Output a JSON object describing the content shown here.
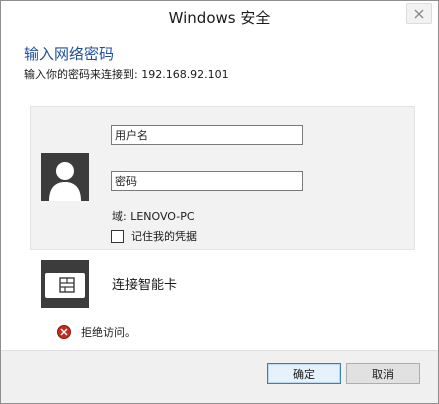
{
  "window": {
    "title": "Windows 安全"
  },
  "header": {
    "title": "输入网络密码",
    "subtitle": "输入你的密码来连接到: 192.168.92.101"
  },
  "credentials": {
    "username_placeholder": "用户名",
    "password_placeholder": "密码",
    "domain": "域: LENOVO-PC",
    "remember_label": "记住我的凭据",
    "remember_checked": false
  },
  "smartcard": {
    "label": "连接智能卡"
  },
  "error": {
    "message": "拒绝访问。"
  },
  "buttons": {
    "ok_label": "确定",
    "cancel_label": "取消"
  },
  "colors": {
    "heading": "#1e4f9a",
    "error": "#c42b1c",
    "tile": "#3c3c3c",
    "primary_border": "#3c7fb1"
  },
  "icons": {
    "close": "close-icon",
    "avatar": "user-avatar-icon",
    "smartcard": "smart-card-icon",
    "error": "error-icon"
  }
}
